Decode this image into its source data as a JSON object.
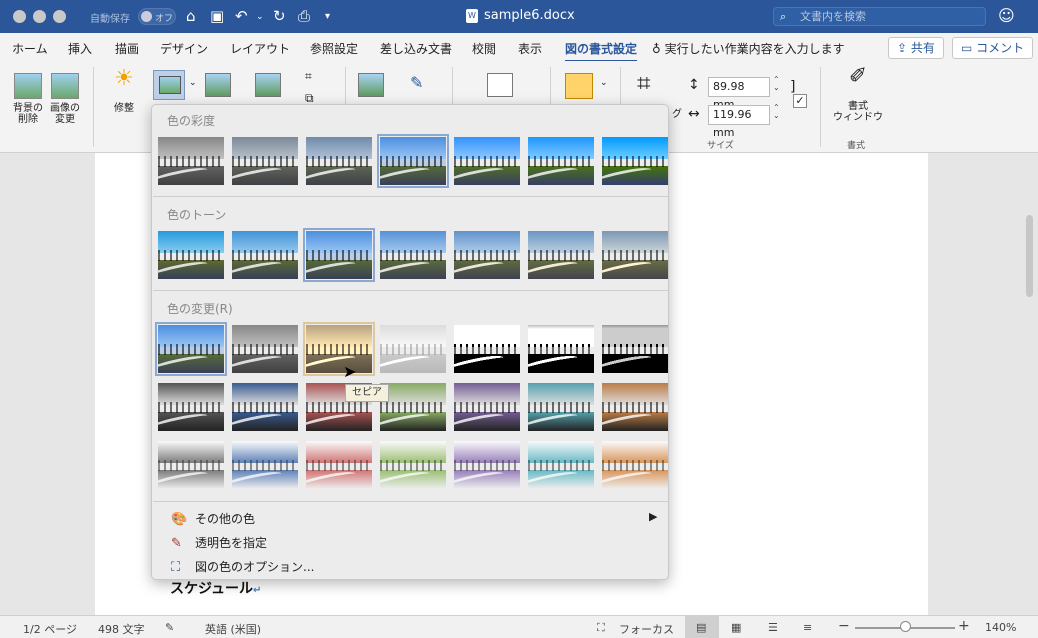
{
  "titlebar": {
    "autosave_label": "自動保存",
    "autosave_state": "オフ",
    "document_title": "sample6.docx",
    "search_placeholder": "文書内を検索"
  },
  "tabs": [
    "ホーム",
    "挿入",
    "描画",
    "デザイン",
    "レイアウト",
    "参照設定",
    "差し込み文書",
    "校閲",
    "表示",
    "図の書式設定"
  ],
  "active_tab": "図の書式設定",
  "tell_me": "実行したい作業内容を入力します",
  "share_label": "共有",
  "comment_label": "コメント",
  "ribbon": {
    "remove_background": "背景の\n削除",
    "change_picture": "画像の\n変更",
    "corrections": "修整",
    "crop_suffix": "グ",
    "height": "89.98 mm",
    "width": "119.96 mm",
    "size_group": "サイズ",
    "format_pane": "書式\nウィンドウ",
    "format_group": "書式"
  },
  "dropdown": {
    "saturation_header": "色の彩度",
    "tone_header": "色のトーン",
    "recolor_header": "色の変更(R)",
    "menu": {
      "more_colors": "その他の色",
      "set_transparent": "透明色を指定",
      "color_options": "図の色のオプション..."
    },
    "tooltip": "セピア"
  },
  "document": {
    "heading": "スケジュール"
  },
  "statusbar": {
    "page": "1/2 ページ",
    "words": "498 文字",
    "language": "英語 (米国)",
    "focus": "フォーカス",
    "zoom": "140%"
  }
}
